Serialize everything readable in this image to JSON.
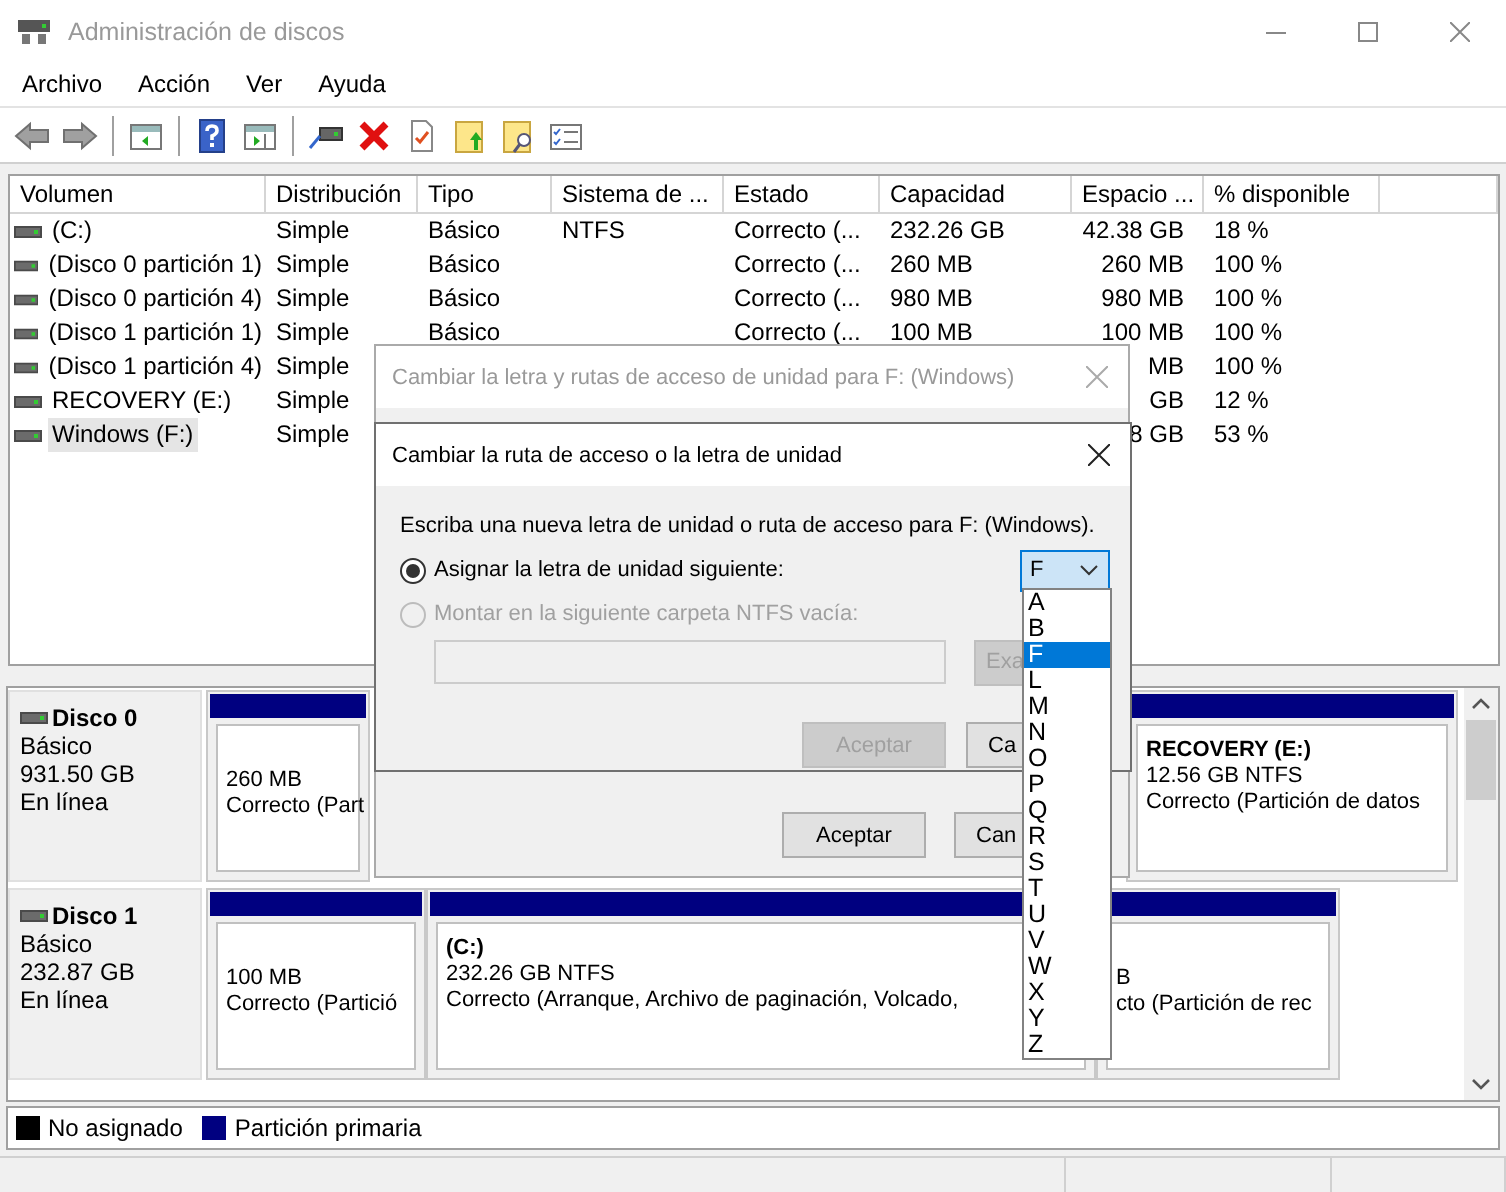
{
  "window": {
    "title": "Administración de discos"
  },
  "menu": [
    "Archivo",
    "Acción",
    "Ver",
    "Ayuda"
  ],
  "table": {
    "columns": [
      "Volumen",
      "Distribución",
      "Tipo",
      "Sistema de ...",
      "Estado",
      "Capacidad",
      "Espacio ...",
      "% disponible"
    ],
    "rows": [
      {
        "volume": "(C:)",
        "layout": "Simple",
        "type": "Básico",
        "file_system": "NTFS",
        "status": "Correcto (...",
        "capacity": "232.26 GB",
        "free": "42.38 GB",
        "percent": "18 %",
        "selected": false
      },
      {
        "volume": "(Disco 0 partición 1)",
        "layout": "Simple",
        "type": "Básico",
        "status": "Correcto (...",
        "capacity": "260 MB",
        "free": "260 MB",
        "percent": "100 %",
        "selected": false
      },
      {
        "volume": "(Disco 0 partición 4)",
        "layout": "Simple",
        "type": "Básico",
        "status": "Correcto (...",
        "capacity": "980 MB",
        "free": "980 MB",
        "percent": "100 %",
        "selected": false
      },
      {
        "volume": "(Disco 1 partición 1)",
        "layout": "Simple",
        "type": "Básico",
        "status": "Correcto (...",
        "capacity": "100 MB",
        "free": "100 MB",
        "percent": "100 %",
        "selected": false
      },
      {
        "volume": "(Disco 1 partición 4)",
        "layout": "Simple",
        "free": "MB",
        "percent": "100 %",
        "selected": false
      },
      {
        "volume": "RECOVERY (E:)",
        "layout": "Simple",
        "free": "GB",
        "percent": "12 %",
        "selected": false
      },
      {
        "volume": "Windows (F:)",
        "layout": "Simple",
        "free": "8 GB",
        "percent": "53 %",
        "selected": true
      }
    ]
  },
  "disks": [
    {
      "name": "Disco 0",
      "type": "Básico",
      "size": "931.50 GB",
      "state": "En línea",
      "partitions": [
        {
          "lines": [
            "260 MB",
            "Correcto (Part"
          ]
        },
        {
          "name": "RECOVERY  (E:)",
          "lines": [
            "12.56 GB NTFS",
            "Correcto (Partición de datos"
          ]
        }
      ]
    },
    {
      "name": "Disco 1",
      "type": "Básico",
      "size": "232.87 GB",
      "state": "En línea",
      "partitions": [
        {
          "lines": [
            "100 MB",
            "Correcto (Partició"
          ]
        },
        {
          "name": "(C:)",
          "lines": [
            "232.26 GB NTFS",
            "Correcto (Arranque, Archivo de paginación, Volcado,"
          ]
        },
        {
          "lines": [
            "B",
            "cto (Partición de rec"
          ]
        }
      ]
    }
  ],
  "legend": [
    {
      "label": "No asignado",
      "color": "#000000"
    },
    {
      "label": "Partición primaria",
      "color": "#000080"
    }
  ],
  "outer_dialog": {
    "title": "Cambiar la letra y rutas de acceso de unidad para F: (Windows)",
    "buttons": [
      {
        "label": "Aceptar",
        "disabled": false
      },
      {
        "label": "Can",
        "disabled": false
      }
    ]
  },
  "inner_dialog": {
    "title": "Cambiar la ruta de acceso o la letra de unidad",
    "prompt": "Escriba una nueva letra de unidad o ruta de acceso para F: (Windows).",
    "options": [
      {
        "label": "Asignar la letra de unidad siguiente:",
        "selected": true,
        "disabled": false
      },
      {
        "label": "Montar en la siguiente carpeta NTFS vacía:",
        "selected": false,
        "disabled": true
      }
    ],
    "drive_letter": {
      "value": "F",
      "options": [
        {
          "label": "A",
          "selected": false
        },
        {
          "label": "B",
          "selected": false
        },
        {
          "label": "F",
          "selected": true
        },
        {
          "label": "L",
          "selected": false
        },
        {
          "label": "M",
          "selected": false
        },
        {
          "label": "N",
          "selected": false
        },
        {
          "label": "O",
          "selected": false
        },
        {
          "label": "P",
          "selected": false
        },
        {
          "label": "Q",
          "selected": false
        },
        {
          "label": "R",
          "selected": false
        },
        {
          "label": "S",
          "selected": false
        },
        {
          "label": "T",
          "selected": false
        },
        {
          "label": "U",
          "selected": false
        },
        {
          "label": "V",
          "selected": false
        },
        {
          "label": "W",
          "selected": false
        },
        {
          "label": "X",
          "selected": false
        },
        {
          "label": "Y",
          "selected": false
        },
        {
          "label": "Z",
          "selected": false
        }
      ]
    },
    "folder_field": {
      "disabled": true
    },
    "browse_button": {
      "label": "Exa",
      "disabled": true
    },
    "buttons": [
      {
        "label": "Aceptar",
        "disabled": true
      },
      {
        "label": "Ca",
        "disabled": false
      }
    ]
  }
}
